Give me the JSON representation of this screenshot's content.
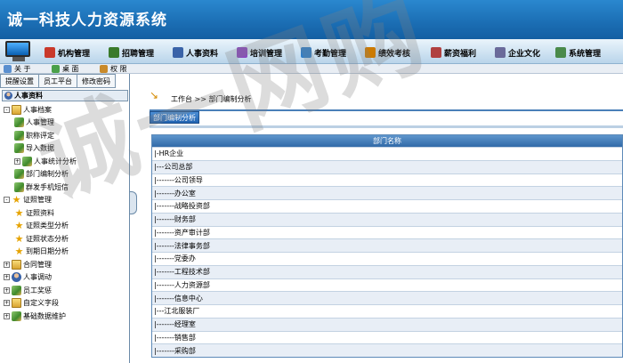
{
  "app": {
    "title": "诚一科技人力资源系统"
  },
  "menu": [
    {
      "label": "机构管理",
      "icon": "org-icon",
      "color": "#c9392b"
    },
    {
      "label": "招聘管理",
      "icon": "recruit-icon",
      "color": "#3a7a2a"
    },
    {
      "label": "人事资料",
      "icon": "personnel-icon",
      "color": "#3a63a8"
    },
    {
      "label": "培训管理",
      "icon": "training-icon",
      "color": "#8a4ac0"
    },
    {
      "label": "考勤管理",
      "icon": "attendance-icon",
      "color": "#2f7ec9"
    },
    {
      "label": "绩效考核",
      "icon": "performance-icon",
      "color": "#cc7a00"
    },
    {
      "label": "薪资福利",
      "icon": "salary-icon",
      "color": "#b04040"
    },
    {
      "label": "企业文化",
      "icon": "culture-icon",
      "color": "#6a6a9a"
    },
    {
      "label": "系统管理",
      "icon": "system-icon",
      "color": "#4a8a4a"
    }
  ],
  "toolbar": {
    "about": "关 于",
    "desktop": "桌 面",
    "shortcut": "权 限"
  },
  "left_tabs": [
    "提醒设置",
    "员工平台",
    "修改密码"
  ],
  "left_header": "人事资料",
  "tree": [
    {
      "label": "人事档案",
      "level": 0,
      "exp": "-",
      "icon": "folder"
    },
    {
      "label": "人事管理",
      "level": 1,
      "icon": "pencil"
    },
    {
      "label": "职称评定",
      "level": 1,
      "icon": "pencil"
    },
    {
      "label": "导入数据",
      "level": 1,
      "icon": "pencil"
    },
    {
      "label": "人事统计分析",
      "level": 1,
      "exp": "+",
      "icon": "pencil"
    },
    {
      "label": "部门编制分析",
      "level": 1,
      "icon": "pencil"
    },
    {
      "label": "群发手机短信",
      "level": 1,
      "icon": "pencil"
    },
    {
      "label": "证照管理",
      "level": 0,
      "exp": "-",
      "icon": "star"
    },
    {
      "label": "证照资料",
      "level": 1,
      "icon": "star"
    },
    {
      "label": "证照类型分析",
      "level": 1,
      "icon": "star"
    },
    {
      "label": "证照状态分析",
      "level": 1,
      "icon": "star"
    },
    {
      "label": "到期日期分析",
      "level": 1,
      "icon": "star"
    },
    {
      "label": "合同管理",
      "level": 0,
      "exp": "+",
      "icon": "folder"
    },
    {
      "label": "人事调动",
      "level": 0,
      "exp": "+",
      "icon": "user"
    },
    {
      "label": "员工奖惩",
      "level": 0,
      "exp": "+",
      "icon": "pencil"
    },
    {
      "label": "自定义字段",
      "level": 0,
      "exp": "+",
      "icon": "folder"
    },
    {
      "label": "基础数据维护",
      "level": 0,
      "exp": "+",
      "icon": "pencil"
    }
  ],
  "breadcrumb": "工作台 >> 部门编制分析",
  "action_button": "部门编制分析",
  "table": {
    "header": "部门名称",
    "rows": [
      "|-HR企业",
      "|---公司总部",
      "|-------公司领导",
      "|-------办公室",
      "|-------战略投资部",
      "|-------财务部",
      "|-------资产审计部",
      "|-------法律事务部",
      "|-------党委办",
      "|-------工程技术部",
      "|-------人力资源部",
      "|-------信息中心",
      "|---江北服装厂",
      "|-------经理室",
      "|-------销售部",
      "|-------采购部"
    ]
  },
  "watermark": "诚一网购"
}
